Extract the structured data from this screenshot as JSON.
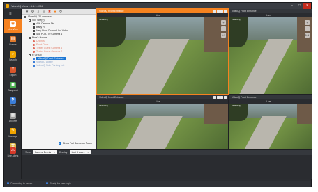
{
  "window": {
    "title": "VideoIQ View - 4.1.1.0112"
  },
  "nav": {
    "items": [
      {
        "label": "Live View",
        "icon": "eye-icon"
      },
      {
        "label": "Events",
        "icon": "events-icon"
      },
      {
        "label": "Search",
        "icon": "search-icon"
      },
      {
        "label": "Export",
        "icon": "export-icon"
      },
      {
        "label": "Snapshot",
        "icon": "snapshot-icon"
      },
      {
        "label": "Rules",
        "icon": "rules-icon"
      },
      {
        "label": "Archive",
        "icon": "archive-icon"
      },
      {
        "label": "Manage",
        "icon": "manage-icon"
      },
      {
        "label": "Tools",
        "icon": "tools-icon"
      },
      {
        "label": "Live Alerts",
        "icon": "alert-icon"
      }
    ]
  },
  "tree": {
    "nodes": [
      {
        "text": "VideoIQ (20 cameras)",
        "indent": 0,
        "kind": "box",
        "state": "normal"
      },
      {
        "text": "404 Site(9)",
        "indent": 1,
        "kind": "box",
        "state": "normal"
      },
      {
        "text": "406 Camera 1bt",
        "indent": 2,
        "kind": "cam",
        "state": "normal"
      },
      {
        "text": "Baby Rr",
        "indent": 2,
        "kind": "cam",
        "state": "normal"
      },
      {
        "text": "Very Poor Channel Lvl Video",
        "indent": 2,
        "kind": "cam",
        "state": "normal"
      },
      {
        "text": "408 PDA770 Camera 4",
        "indent": 2,
        "kind": "cam",
        "state": "normal"
      },
      {
        "text": "Pine's House",
        "indent": 1,
        "kind": "box",
        "state": "normal"
      },
      {
        "text": "Unlinks",
        "indent": 2,
        "kind": "red",
        "state": "off"
      },
      {
        "text": "Front Door",
        "indent": 2,
        "kind": "red",
        "state": "off"
      },
      {
        "text": "Tester Guest Camera 4",
        "indent": 2,
        "kind": "red",
        "state": "off"
      },
      {
        "text": "Tester Guest Camera 2",
        "indent": 2,
        "kind": "red",
        "state": "off"
      },
      {
        "text": "R Group",
        "indent": 1,
        "kind": "box",
        "state": "normal"
      },
      {
        "text": "VideoIQ Front Entrance",
        "indent": 2,
        "kind": "blue",
        "state": "selected"
      },
      {
        "text": "VideoIQ Lobby",
        "indent": 2,
        "kind": "blue",
        "state": "gray"
      },
      {
        "text": "VideoIQ Side Parking Lot",
        "indent": 2,
        "kind": "blue",
        "state": "gray"
      }
    ],
    "fullscreen_label": "Show Full Scene on Zoom"
  },
  "tiles": [
    {
      "title": "VideoIQ Front Entrance",
      "sub": "Live",
      "stamp": "VIDEOIQ",
      "active": true,
      "dark": false
    },
    {
      "title": "VideoIQ Front Entrance",
      "sub": "Live",
      "stamp": "VIDEOIQ",
      "active": false,
      "dark": false
    },
    {
      "title": "VideoIQ Front Entrance",
      "sub": "Live",
      "stamp": "VIDEOIQ",
      "active": false,
      "dark": false
    },
    {
      "title": "VideoIQ Front Entrance",
      "sub": "Live",
      "stamp": "VIDEOIQ",
      "active": false,
      "dark": false
    }
  ],
  "bottombar": {
    "view_label": "View",
    "view_value": "Camera Events",
    "display_label": "Display",
    "display_value": "Last 3 hours"
  },
  "statusbar": {
    "left": "Connecting to server",
    "right": "Ready for user login"
  }
}
